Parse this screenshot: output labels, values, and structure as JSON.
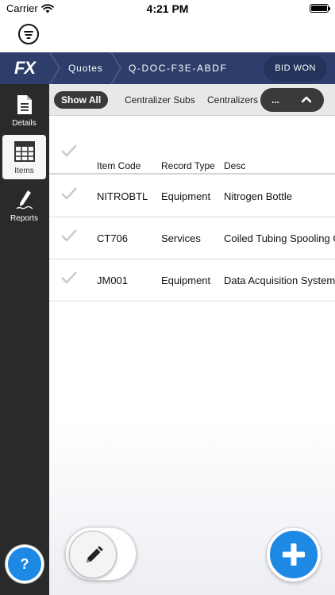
{
  "status_bar": {
    "carrier": "Carrier",
    "time": "4:21 PM",
    "battery_level": 1.0
  },
  "header": {
    "logo": "FX",
    "breadcrumbs": [
      "Quotes",
      "Q-DOC-F3E-ABDF"
    ],
    "status_badge": "BID WON"
  },
  "sidebar": {
    "items": [
      {
        "label": "Details",
        "icon": "document-icon"
      },
      {
        "label": "Items",
        "icon": "table-icon",
        "active": true
      },
      {
        "label": "Reports",
        "icon": "pen-icon"
      }
    ],
    "help_label": "?"
  },
  "filter_tabs": {
    "items": [
      "Show All",
      "Centralizer Subs",
      "Centralizers"
    ],
    "active": "Show All",
    "more_label": "..."
  },
  "table": {
    "columns": [
      "Item Code",
      "Record Type",
      "Desc"
    ],
    "rows": [
      {
        "code": "NITROBTL",
        "type": "Equipment",
        "desc": "Nitrogen Bottle"
      },
      {
        "code": "CT706",
        "type": "Services",
        "desc": "Coiled Tubing Spooling Cl"
      },
      {
        "code": "JM001",
        "type": "Equipment",
        "desc": "Data Acquisition System"
      }
    ]
  },
  "colors": {
    "navbar": "#2d3e6b",
    "sidebar": "#2a2a2a",
    "accent_blue": "#1e88e5",
    "chip_dark": "#3a3a3a"
  }
}
